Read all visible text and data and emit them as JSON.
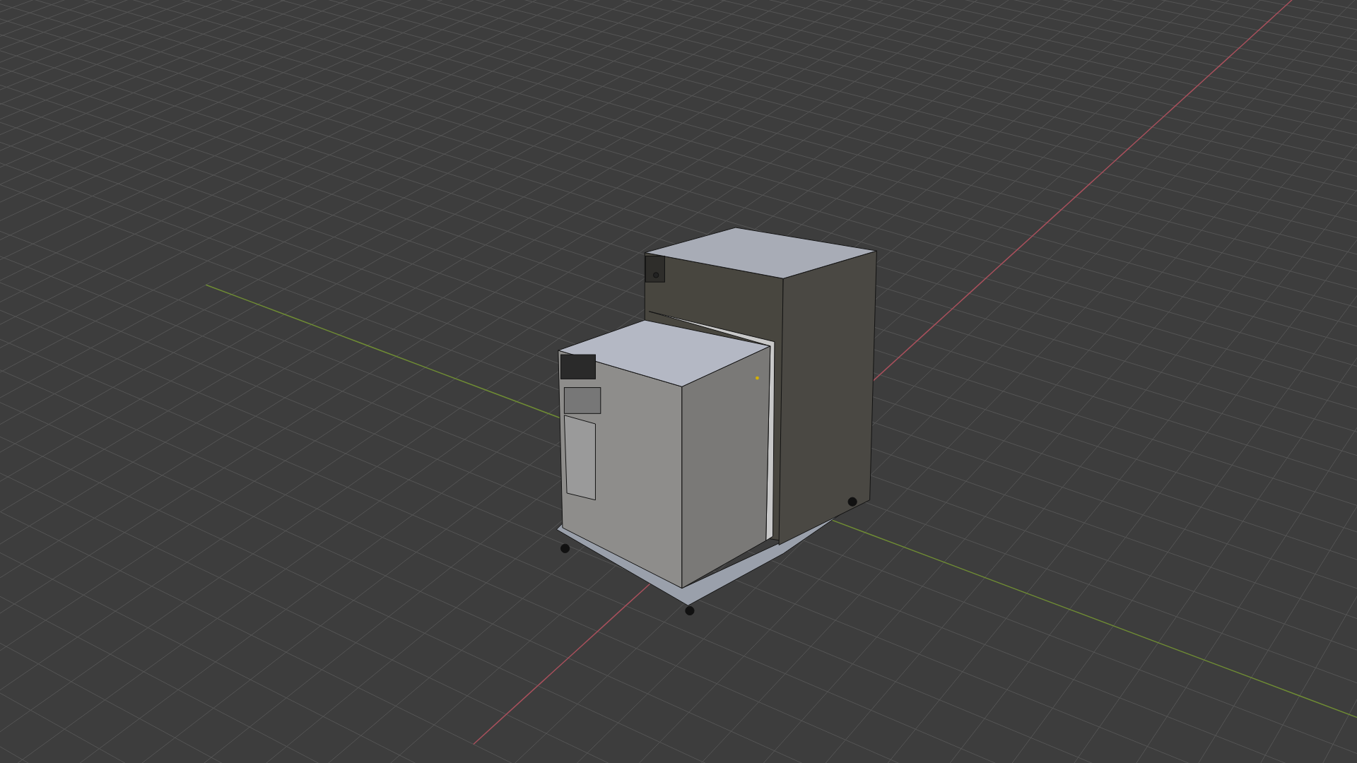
{
  "viewport": {
    "kind": "viewport",
    "grid": true,
    "axes": [
      {
        "kind": "x",
        "color": "#a8505c"
      },
      {
        "kind": "y",
        "color": "#6f8c34"
      }
    ]
  }
}
